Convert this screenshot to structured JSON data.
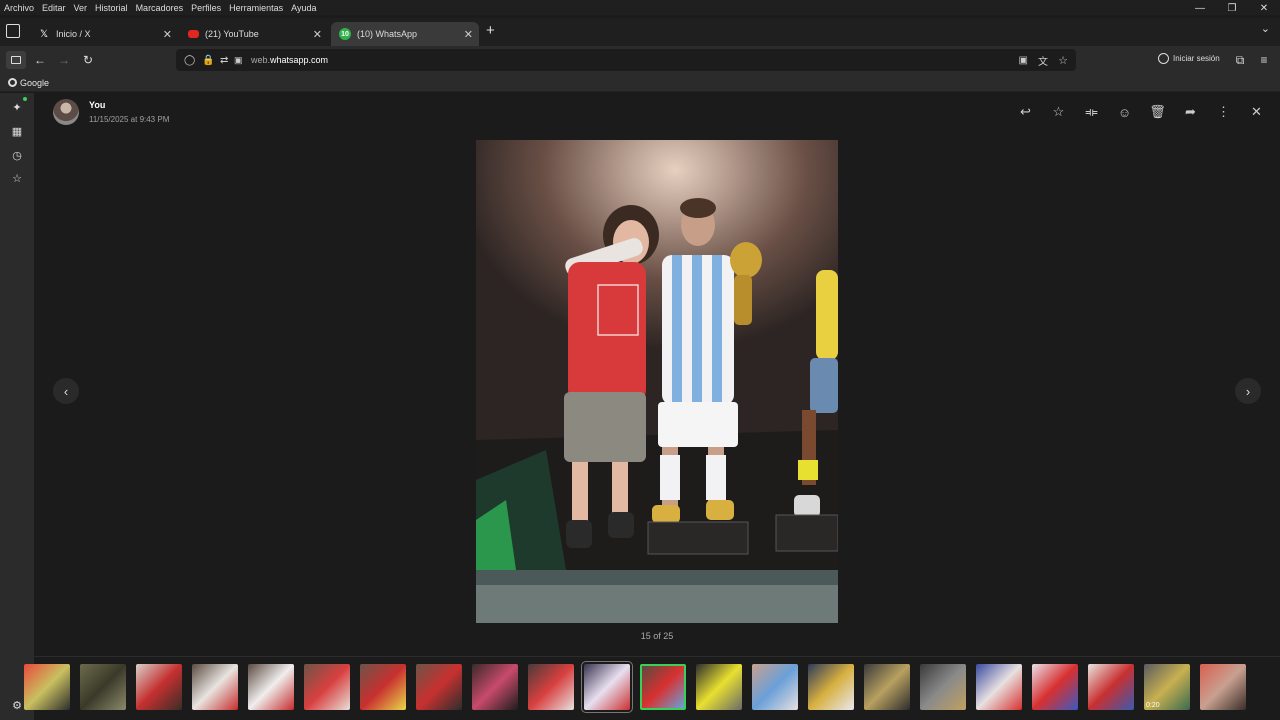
{
  "menu": [
    "Archivo",
    "Editar",
    "Ver",
    "Historial",
    "Marcadores",
    "Perfiles",
    "Herramientas",
    "Ayuda"
  ],
  "tabs": [
    {
      "label": "Inicio / X",
      "icon": "x-logo-icon"
    },
    {
      "label": "(21) YouTube",
      "icon": "youtube-icon"
    },
    {
      "label": "(10) WhatsApp",
      "icon": "whatsapp-icon",
      "badge": "10",
      "active": true
    }
  ],
  "address": {
    "host_prefix": "web.",
    "host": "whatsapp.com"
  },
  "account": {
    "label": "Iniciar sesión"
  },
  "bookmarks": [
    {
      "label": "Google"
    }
  ],
  "viewer": {
    "sender": "You",
    "timestamp": "11/15/2025 at 9:43 PM",
    "counter": "15 of 25",
    "current_index": 15,
    "total": 25
  },
  "thumbnails": [
    {
      "colors": [
        "#e84a3a",
        "#c8c060",
        "#2d2d2d"
      ]
    },
    {
      "colors": [
        "#6d6a4a",
        "#3a3a2a",
        "#8c8a6a"
      ]
    },
    {
      "colors": [
        "#d8d0c8",
        "#c43030",
        "#3a2d28"
      ]
    },
    {
      "colors": [
        "#5a4a40",
        "#e8e4e0",
        "#c42c2c"
      ]
    },
    {
      "colors": [
        "#5a4a40",
        "#f0eeee",
        "#c42c2c"
      ]
    },
    {
      "colors": [
        "#6d5447",
        "#d84040",
        "#e8e0d8"
      ]
    },
    {
      "colors": [
        "#6d5447",
        "#c83030",
        "#e8d848"
      ]
    },
    {
      "colors": [
        "#6d5447",
        "#c83030",
        "#2d2d2d"
      ]
    },
    {
      "colors": [
        "#3a2a2a",
        "#c84a6a",
        "#1d1d1d"
      ]
    },
    {
      "colors": [
        "#4a3a3a",
        "#d84040",
        "#e8e0e0"
      ]
    },
    {
      "colors": [
        "#3a3450",
        "#e8e0f0",
        "#c83030"
      ]
    },
    {
      "colors": [
        "#5a4a40",
        "#d83030",
        "#6aa0d8"
      ]
    },
    {
      "colors": [
        "#2d2d2d",
        "#e8e030",
        "#6a6a6a"
      ]
    },
    {
      "colors": [
        "#c8a090",
        "#6aa0d8",
        "#e8e0e0"
      ]
    },
    {
      "colors": [
        "#2d3a5a",
        "#d8b040",
        "#e8e8f0"
      ]
    },
    {
      "colors": [
        "#3a3a3a",
        "#b8a060",
        "#2d2d2d"
      ]
    },
    {
      "colors": [
        "#3a3a3a",
        "#8a8a8a",
        "#c0a060"
      ]
    },
    {
      "colors": [
        "#3a4aa0",
        "#e8e0e0",
        "#d83030"
      ]
    },
    {
      "colors": [
        "#e8e0e8",
        "#d83030",
        "#3a5ac0"
      ]
    },
    {
      "colors": [
        "#e8e4e0",
        "#c83030",
        "#3a5ab0"
      ]
    },
    {
      "colors": [
        "#5a5a60",
        "#c8b050",
        "#3a6a50"
      ],
      "video": "0:20"
    },
    {
      "colors": [
        "#d86050",
        "#c8a090",
        "#3a2d28"
      ]
    }
  ],
  "colors": {
    "accent": "#3ad057"
  }
}
